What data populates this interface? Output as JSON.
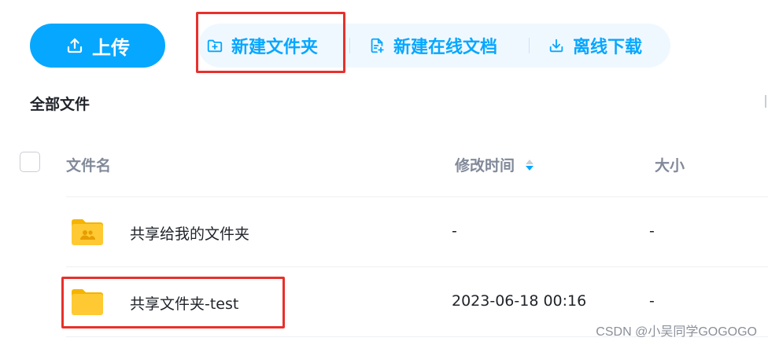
{
  "toolbar": {
    "upload_label": "上传",
    "new_folder_label": "新建文件夹",
    "new_online_doc_label": "新建在线文档",
    "offline_download_label": "离线下载"
  },
  "breadcrumb": {
    "current": "全部文件"
  },
  "table": {
    "headers": {
      "name": "文件名",
      "modified": "修改时间",
      "size": "大小"
    },
    "rows": [
      {
        "name": "共享给我的文件夹",
        "modified": "-",
        "size": "-",
        "icon": "shared-folder-icon"
      },
      {
        "name": "共享文件夹-test",
        "modified": "2023-06-18 00:16",
        "size": "-",
        "icon": "folder-icon"
      }
    ]
  },
  "watermark": "CSDN @小吴同学GOGOGO",
  "colors": {
    "accent": "#06a7ff",
    "highlight": "#e8302c",
    "folder": "#ffc933"
  }
}
